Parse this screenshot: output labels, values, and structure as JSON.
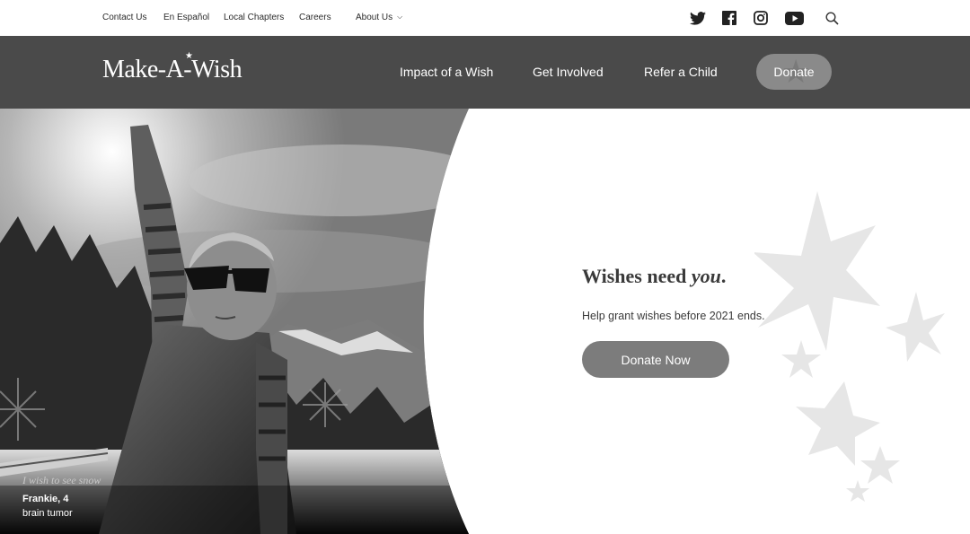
{
  "utility_nav": {
    "links": [
      "Contact Us",
      "En Español",
      "Local Chapters",
      "Careers",
      "About Us"
    ],
    "social_icons": [
      "twitter-icon",
      "facebook-icon",
      "instagram-icon",
      "youtube-icon",
      "search-icon"
    ]
  },
  "main_nav": {
    "logo": "Make-A-Wish",
    "items": [
      "Impact of a Wish",
      "Get Involved",
      "Refer a Child"
    ],
    "donate_label": "Donate"
  },
  "hero": {
    "headline_prefix": "Wishes need ",
    "headline_emphasis": "you",
    "headline_suffix": ".",
    "subtext": "Help grant wishes before 2021 ends.",
    "cta_label": "Donate Now",
    "caption_quote": "I wish to see snow",
    "caption_name": "Frankie, 4",
    "caption_condition": "brain tumor"
  },
  "colors": {
    "nav_background": "#4a4a4a",
    "button_gray": "#7c7c7c",
    "star_gray": "#e6e6e6"
  }
}
